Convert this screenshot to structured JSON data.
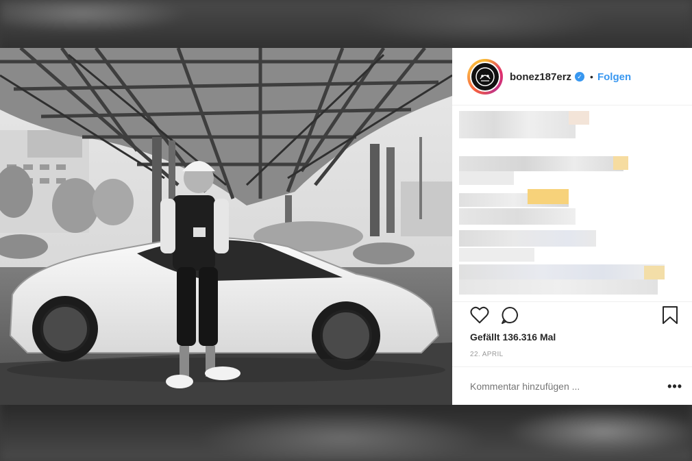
{
  "post": {
    "username": "bonez187erz",
    "separator": "•",
    "follow_label": "Folgen",
    "likes_text": "Gefällt 136.316 Mal",
    "date": "22. APRIL",
    "comment_placeholder": "Kommentar hinzufügen ...",
    "more_label": "•••",
    "verified": true
  },
  "icons": {
    "like": "heart-outline-icon",
    "comment": "comment-bubble-icon",
    "save": "bookmark-icon",
    "verified": "verified-badge-icon"
  },
  "colors": {
    "link_blue": "#3897f0",
    "text_dark": "#262626",
    "text_muted": "#999999"
  }
}
